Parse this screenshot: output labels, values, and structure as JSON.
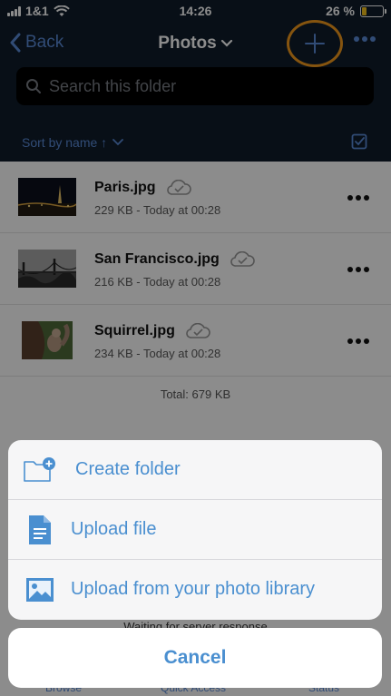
{
  "status_bar": {
    "carrier": "1&1",
    "time": "14:26",
    "battery_text": "26 %",
    "battery_level": 0.26,
    "battery_color": "#f4c21c"
  },
  "nav": {
    "back_label": "Back",
    "title": "Photos",
    "add_icon": "plus-icon",
    "more_icon": "ellipsis-icon"
  },
  "search": {
    "placeholder": "Search this folder"
  },
  "sort": {
    "label": "Sort by name ↑"
  },
  "files": [
    {
      "name": "Paris.jpg",
      "meta": "229 KB - Today at 00:28",
      "thumb": "paris-night-photo"
    },
    {
      "name": "San Francisco.jpg",
      "meta": "216 KB - Today at 00:28",
      "thumb": "golden-gate-bridge-photo"
    },
    {
      "name": "Squirrel.jpg",
      "meta": "234 KB - Today at 00:28",
      "thumb": "squirrel-photo"
    }
  ],
  "total": "Total: 679 KB",
  "bottom_status": "Waiting for server response",
  "tabs": [
    "Browse",
    "Quick Access",
    "Status"
  ],
  "action_sheet": {
    "items": [
      {
        "label": "Create folder",
        "icon": "folder-plus-icon"
      },
      {
        "label": "Upload file",
        "icon": "document-icon"
      },
      {
        "label": "Upload from your photo library",
        "icon": "photo-icon"
      }
    ],
    "cancel_label": "Cancel"
  },
  "colors": {
    "accent": "#4a8fd0",
    "header_bg": "#0f1c2a",
    "highlight_ring": "#f39a1d"
  }
}
